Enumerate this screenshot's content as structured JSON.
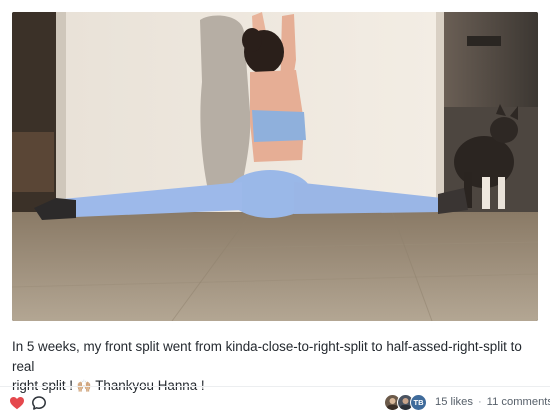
{
  "post": {
    "caption_line1": "In 5 weeks, my front split went from kinda-close-to-right-split to half-assed-right-split to real",
    "caption_line2_prefix": "right split !",
    "caption_emoji": "🙌🏼",
    "caption_line2_suffix": "Thankyou Hanna !",
    "media_icon": "photo-of-person-doing-front-split"
  },
  "actions": {
    "like_icon": "heart-icon",
    "comment_icon": "comment-bubble-icon",
    "accent_color": "#e5484d",
    "avatar_initials": "TB",
    "likes_label": "15 likes",
    "separator": "·",
    "comments_label": "11 comments"
  }
}
